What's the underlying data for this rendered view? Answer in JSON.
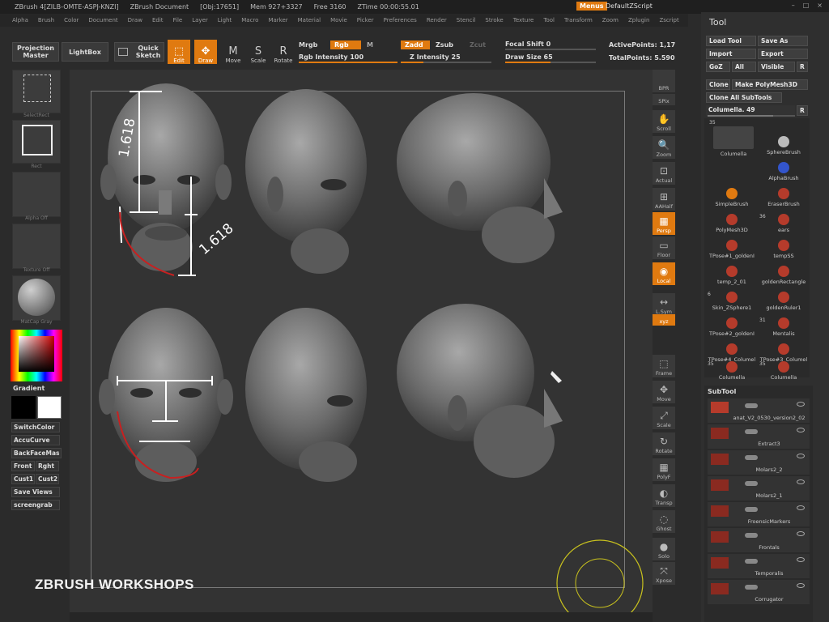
{
  "titlebar": {
    "app": "ZBrush 4[ZILB-OMTE-ASPJ-KNZI]",
    "document": "ZBrush Document",
    "obj": "[Obj:17651]",
    "mem": "Mem 927+3327",
    "free": "Free 3160",
    "ztime": "ZTime 00:00:55.01",
    "menus": "Menus",
    "script": "DefaultZScript",
    "min": "–",
    "max": "□",
    "close": "×"
  },
  "menubar": [
    "Alpha",
    "Brush",
    "Color",
    "Document",
    "Draw",
    "Edit",
    "File",
    "Layer",
    "Light",
    "Macro",
    "Marker",
    "Material",
    "Movie",
    "Picker",
    "Preferences",
    "Render",
    "Stencil",
    "Stroke",
    "Texture",
    "Tool",
    "Transform",
    "Zoom",
    "Zplugin",
    "Zscript"
  ],
  "toolbar": {
    "projection_master": "Projection Master",
    "lightbox": "LightBox",
    "quick_sketch": "Quick Sketch",
    "modes": [
      {
        "label": "Edit",
        "glyph": "⬚",
        "active": true
      },
      {
        "label": "Draw",
        "glyph": "✥",
        "active": true
      },
      {
        "label": "Move",
        "glyph": "M",
        "active": false
      },
      {
        "label": "Scale",
        "glyph": "S",
        "active": false
      },
      {
        "label": "Rotate",
        "glyph": "R",
        "active": false
      }
    ],
    "mrgb": "Mrgb",
    "rgb": "Rgb",
    "m": "M",
    "zadd": "Zadd",
    "zsub": "Zsub",
    "zcut": "Zcut",
    "rgb_intensity": "Rgb Intensity 100",
    "z_intensity": "Z Intensity 25",
    "focal_shift": "Focal Shift 0",
    "draw_size": "Draw Size 65",
    "active_points": "ActivePoints: 1,17",
    "total_points": "TotalPoints: 5.590"
  },
  "leftpanel": {
    "selectrect": "SelectRect",
    "rect": "Rect",
    "alpha_off": "Alpha Off",
    "texture_off": "Texture Off",
    "matcap": "MatCap Gray",
    "gradient": "Gradient",
    "switchcolor": "SwitchColor",
    "accucurve": "AccuCurve",
    "backface": "BackFaceMas",
    "front": "Front",
    "right": "Rght",
    "cust1": "Cust1",
    "cust2": "Cust2",
    "save_views": "Save Views",
    "screengrab": "screengrab"
  },
  "canvas": {
    "annotation_top_left": "1.618",
    "annotation_top_right": "1.618"
  },
  "shelf": [
    {
      "label": "BPR",
      "glyph": "",
      "orange": false
    },
    {
      "label": "SPix",
      "glyph": "",
      "orange": false
    },
    {
      "label": "Scroll",
      "glyph": "✋",
      "orange": false
    },
    {
      "label": "Zoom",
      "glyph": "🔍",
      "orange": false
    },
    {
      "label": "Actual",
      "glyph": "⊡",
      "orange": false
    },
    {
      "label": "AAHalf",
      "glyph": "⊞",
      "orange": false
    },
    {
      "label": "Persp",
      "glyph": "▦",
      "orange": true
    },
    {
      "label": "Floor",
      "glyph": "▭",
      "orange": false
    },
    {
      "label": "Local",
      "glyph": "◉",
      "orange": true
    },
    {
      "label": "L.Sym",
      "glyph": "↔",
      "orange": false
    },
    {
      "label": "xyz",
      "glyph": "",
      "orange": true
    },
    {
      "label": "Frame",
      "glyph": "⬚",
      "orange": false
    },
    {
      "label": "Move",
      "glyph": "✥",
      "orange": false
    },
    {
      "label": "Scale",
      "glyph": "⤢",
      "orange": false
    },
    {
      "label": "Rotate",
      "glyph": "↻",
      "orange": false
    },
    {
      "label": "PolyF",
      "glyph": "▦",
      "orange": false
    },
    {
      "label": "Transp",
      "glyph": "◐",
      "orange": false
    },
    {
      "label": "Ghost",
      "glyph": "◌",
      "orange": false
    },
    {
      "label": "Solo",
      "glyph": "●",
      "orange": false
    },
    {
      "label": "Xpose",
      "glyph": "⤧",
      "orange": false
    }
  ],
  "rightpanel": {
    "title": "Tool",
    "load_tool": "Load Tool",
    "save_as": "Save As",
    "import": "Import",
    "export": "Export",
    "goz": "GoZ",
    "all": "All",
    "visible": "Visible",
    "r": "R",
    "clone": "Clone",
    "make_polymesh": "Make PolyMesh3D",
    "clone_all": "Clone All SubTools",
    "current_tool": "Columella. 49",
    "brushes": [
      {
        "name": "Columella",
        "count": "35"
      },
      {
        "name": "SphereBrush",
        "count": ""
      },
      {
        "name": "AlphaBrush",
        "count": ""
      },
      {
        "name": "SimpleBrush",
        "count": ""
      },
      {
        "name": "EraserBrush",
        "count": ""
      },
      {
        "name": "PolyMesh3D",
        "count": ""
      },
      {
        "name": "ears",
        "count": "36"
      },
      {
        "name": "TPose#1_goldenI",
        "count": ""
      },
      {
        "name": "tempSS",
        "count": ""
      },
      {
        "name": "temp_2_01",
        "count": ""
      },
      {
        "name": "goldenRectangle",
        "count": ""
      },
      {
        "name": "Skin_ZSphere1",
        "count": "6"
      },
      {
        "name": "goldenRuler1",
        "count": ""
      },
      {
        "name": "TPose#2_goldenI",
        "count": ""
      },
      {
        "name": "Mentalis",
        "count": "31"
      },
      {
        "name": "TPose#4_Columel",
        "count": ""
      },
      {
        "name": "TPose#3_Columel",
        "count": ""
      },
      {
        "name": "Columella",
        "count": "35"
      },
      {
        "name": "Columella",
        "count": "35"
      }
    ],
    "subtool_title": "SubTool",
    "subtools": [
      "anat_V2_0530_version2_02",
      "Extract3",
      "Molars2_2",
      "Molars2_1",
      "FroensicMarkers",
      "Frontals",
      "Temporalis",
      "Corrugator"
    ]
  },
  "watermark": "ZBRUSH WORKSHOPS",
  "colors": {
    "accent": "#e07a10",
    "panel": "#2f2f2f",
    "canvas": "#333333"
  }
}
